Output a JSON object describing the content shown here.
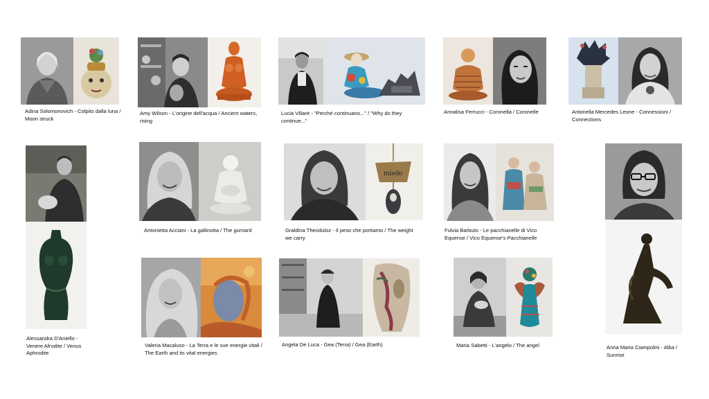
{
  "captions": {
    "c1": "Adina Solomonovich - Colpito dalla luna / Moon struck",
    "c2": "Amy Wilson - L'origine dell'acqua / Ancient waters, rising",
    "c3": "Lucia Villarè - \"Perché continuano...\" / \"Why do they continue...\"",
    "c4": "Annalisa Ferrucci - Coronella / Coronelle",
    "c5": "Antonella Mercedes Leone - Connessioni / Connections",
    "c6": "Alessandra D'Aniello - Venere Afrodite / Venus Aphrodite",
    "c7": "Antonietta Acciani - La gallinotta / The gurnard",
    "c8": "Graldina Theoduloz - Il peso che portiamo / The weight we carry",
    "c9a": "Fulvia Barbuto - Le pacchianelle di Vico Equense / Vico Equense's ",
    "c9b": "Pacchianelle",
    "c10": "Anna Maria Ciampolini - Alba / Sunrise",
    "c11": "Valeria Macaluso - La Terra e le sue energie  vitali / The Earth and its vital energies",
    "c12": "Angela De Luca - Gea (Terra) / Gea (Earth)",
    "c13": "Maria Sabetti - L'angelo / The angel"
  },
  "sculpture_text": "miedo"
}
